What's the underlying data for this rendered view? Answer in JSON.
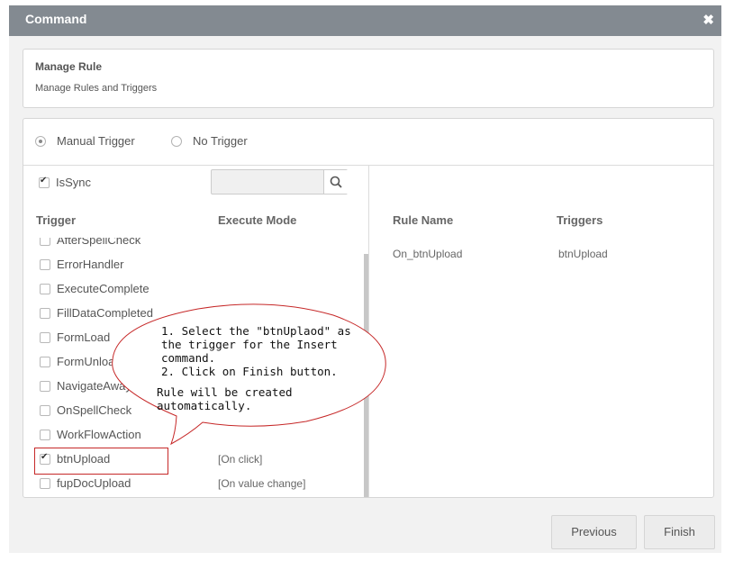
{
  "dialog": {
    "title": "Command",
    "close_icon": "close-icon"
  },
  "manage_rule": {
    "title": "Manage Rule",
    "subtitle": "Manage Rules and Triggers"
  },
  "trigger_mode": {
    "options": [
      {
        "label": "Manual Trigger",
        "selected": true
      },
      {
        "label": "No Trigger",
        "selected": false
      }
    ]
  },
  "issync": {
    "label": "IsSync",
    "checked": true
  },
  "search": {
    "value": "",
    "placeholder": "",
    "icon": "search-icon"
  },
  "left_table": {
    "headers": [
      "Trigger",
      "Execute Mode"
    ],
    "rows": [
      {
        "trigger": "AfterSpellCheck",
        "mode": "",
        "checked": false
      },
      {
        "trigger": "ErrorHandler",
        "mode": "",
        "checked": false
      },
      {
        "trigger": "ExecuteComplete",
        "mode": "",
        "checked": false
      },
      {
        "trigger": "FillDataCompleted",
        "mode": "",
        "checked": false
      },
      {
        "trigger": "FormLoad",
        "mode": "",
        "checked": false
      },
      {
        "trigger": "FormUnload",
        "mode": "",
        "checked": false
      },
      {
        "trigger": "NavigateAway",
        "mode": "",
        "checked": false
      },
      {
        "trigger": "OnSpellCheck",
        "mode": "",
        "checked": false
      },
      {
        "trigger": "WorkFlowAction",
        "mode": "",
        "checked": false
      },
      {
        "trigger": "btnUpload",
        "mode": "[On click]",
        "checked": true
      },
      {
        "trigger": "fupDocUpload",
        "mode": "[On value change]",
        "checked": false
      }
    ]
  },
  "right_table": {
    "headers": [
      "Rule Name",
      "Triggers"
    ],
    "rows": [
      {
        "rule_name": "On_btnUpload",
        "triggers": "btnUpload"
      }
    ]
  },
  "callout": {
    "line1": "1. Select the \"btnUplaod\" as\nthe trigger for the Insert\ncommand.\n2. Click on Finish button.",
    "line2": "Rule will be created\nautomatically."
  },
  "footer": {
    "previous_label": "Previous",
    "finish_label": "Finish"
  },
  "colors": {
    "titlebar": "#838a91",
    "highlight": "#c62828",
    "callout_stroke": "#c62828"
  }
}
